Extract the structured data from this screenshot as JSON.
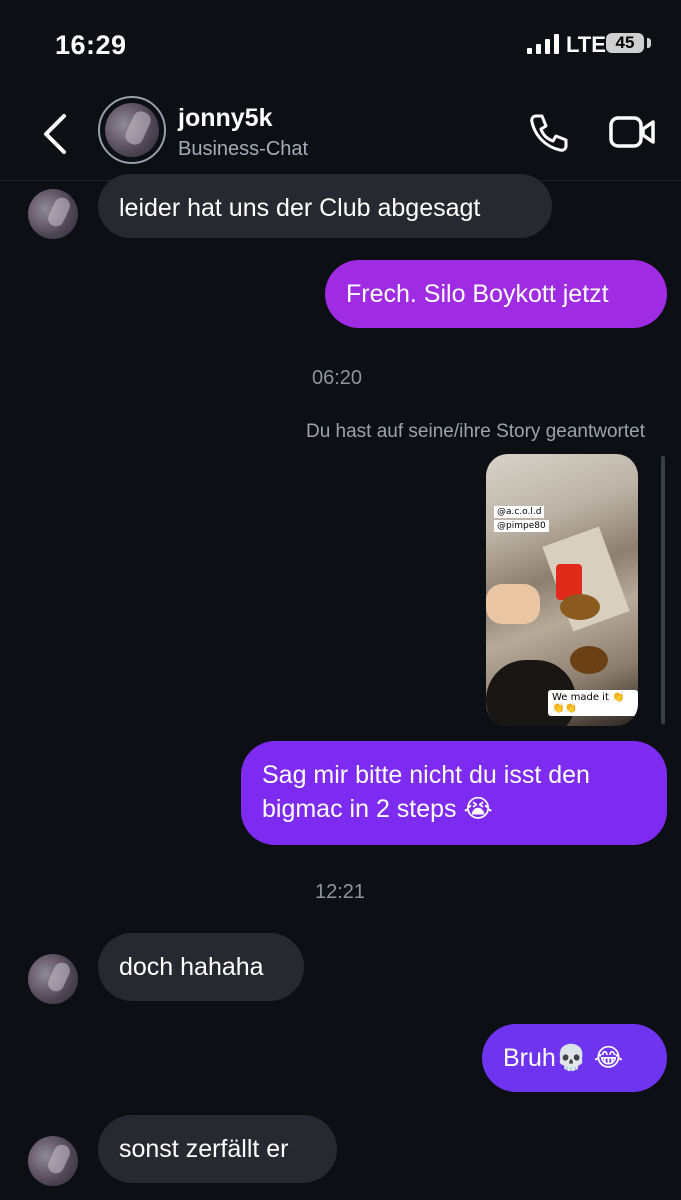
{
  "status": {
    "time": "16:29",
    "network": "LTE",
    "battery": "45"
  },
  "header": {
    "name": "jonny5k",
    "subtitle": "Business-Chat"
  },
  "colors": {
    "background": "#0c0f14",
    "incoming_bubble": "#262a30",
    "outgoing_bubble_1": "#9f2be3",
    "outgoing_bubble_2": "#7e2bf1",
    "outgoing_bubble_3": "#6f34f0"
  },
  "messages": [
    {
      "dir": "in",
      "text": "leider hat uns der Club abgesagt"
    },
    {
      "dir": "out",
      "text": "Frech. Silo Boykott jetzt"
    },
    {
      "type": "time",
      "text": "06:20"
    },
    {
      "type": "note",
      "text": "Du hast auf seine/ihre Story geantwortet"
    },
    {
      "type": "story",
      "tag1": "@a.c.o.l.d",
      "tag2": "@pimpe80",
      "caption": "We made it 👏👏👏"
    },
    {
      "dir": "out",
      "text": "Sag mir bitte nicht du isst den bigmac in 2 steps 😭"
    },
    {
      "type": "time",
      "text": "12:21"
    },
    {
      "dir": "in",
      "text": "doch hahaha"
    },
    {
      "dir": "out",
      "text": "Bruh💀 😂"
    },
    {
      "dir": "in",
      "text": "sonst zerfällt er"
    }
  ],
  "icons": [
    "back-icon",
    "phone-icon",
    "video-icon",
    "signal-icon",
    "battery-icon"
  ]
}
